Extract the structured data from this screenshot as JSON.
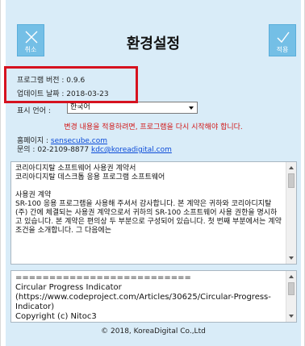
{
  "header": {
    "title": "환경설정",
    "cancel_label": "취소",
    "apply_label": "적용"
  },
  "info": {
    "version": "프로그램 버전 : 0.9.6",
    "updated": "업데이트 날짜 : 2018-03-23"
  },
  "language": {
    "label": "표시 언어 :",
    "selected": "한국어"
  },
  "warning": "변경 내용을 적용하려면, 프로그램을 다시 시작해야 합니다.",
  "contact": {
    "homepage_label": "홈페이지 :",
    "homepage_url": "sensecube.com",
    "phone_label": "문의 :",
    "phone": "02-2109-8877",
    "email": "kdc@koreadigital.com"
  },
  "license_text": "코리아디지탈 소프트웨어 사용권 계약서\n코리아디지탈 데스크톱 응용 프로그램 소프트웨어\n\n사용권 계약\nSR-100 응용 프로그램을 사용해 주셔서 감사합니다. 본 계약은 귀하와 코리아디지탈(주) 간에 체결되는 사용권 계약으로서 귀하의 SR-100 소프트웨어 사용 권한을 명시하고 있습니다. 본 계약은 편의상 두 부분으로 구성되어 있습니다. 첫 번째 부분에서는 계약조건을 소개합니다. 그 다음에는",
  "credits_text": "==========================\nCircular Progress Indicator\n(https://www.codeproject.com/Articles/30625/Circular-Progress-Indicator)\nCopyright (c) Nitoc3",
  "footer": "© 2018, KoreaDigital Co.,Ltd",
  "colors": {
    "panel_bg": "#d9ecf8",
    "button_bg": "#74bfe6",
    "highlight": "#d6121f",
    "warning": "#d11818",
    "link": "#0b4bd8"
  }
}
